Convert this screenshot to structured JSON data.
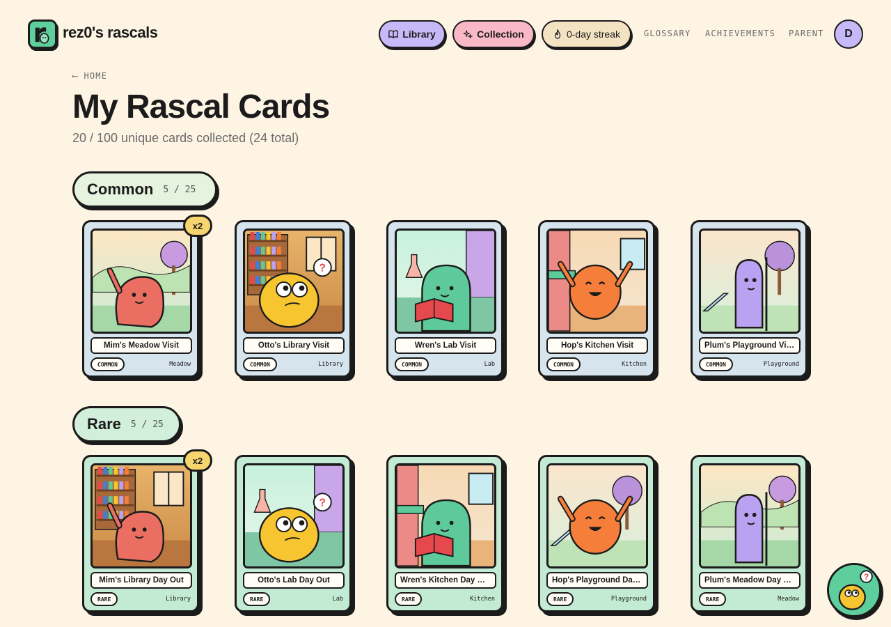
{
  "header": {
    "brand": "rez0's rascals",
    "nav": {
      "library": "Library",
      "collection": "Collection",
      "streak": "0-day streak",
      "glossary": "GLOSSARY",
      "achievements": "ACHIEVEMENTS",
      "parent": "PARENT"
    },
    "avatar_initial": "D"
  },
  "page": {
    "back": "HOME",
    "title": "My Rascal Cards",
    "subtitle": "20 / 100 unique cards collected (24 total)"
  },
  "sections": {
    "common": {
      "name": "Common",
      "count": "5 / 25"
    },
    "rare": {
      "name": "Rare",
      "count": "5 / 25"
    }
  },
  "cards": {
    "common": [
      {
        "title": "Mim's Meadow Visit",
        "rarity": "COMMON",
        "location": "Meadow",
        "dup": "x2",
        "character": "Mim",
        "color": "#ea6f62"
      },
      {
        "title": "Otto's Library Visit",
        "rarity": "COMMON",
        "location": "Library",
        "character": "Otto",
        "color": "#f6c52f"
      },
      {
        "title": "Wren's Lab Visit",
        "rarity": "COMMON",
        "location": "Lab",
        "character": "Wren",
        "color": "#5ec99a"
      },
      {
        "title": "Hop's Kitchen Visit",
        "rarity": "COMMON",
        "location": "Kitchen",
        "character": "Hop",
        "color": "#f57f3a"
      },
      {
        "title": "Plum's Playground Visit",
        "rarity": "COMMON",
        "location": "Playground",
        "character": "Plum",
        "color": "#b9a2f1"
      }
    ],
    "rare": [
      {
        "title": "Mim's Library Day Out",
        "rarity": "RARE",
        "location": "Library",
        "dup": "x2",
        "character": "Mim",
        "color": "#ea6f62"
      },
      {
        "title": "Otto's Lab Day Out",
        "rarity": "RARE",
        "location": "Lab",
        "character": "Otto",
        "color": "#f6c52f"
      },
      {
        "title": "Wren's Kitchen Day Out",
        "rarity": "RARE",
        "location": "Kitchen",
        "character": "Wren",
        "color": "#5ec99a"
      },
      {
        "title": "Hop's Playground Day ...",
        "rarity": "RARE",
        "location": "Playground",
        "character": "Hop",
        "color": "#f57f3a"
      },
      {
        "title": "Plum's Meadow Day O...",
        "rarity": "RARE",
        "location": "Meadow",
        "character": "Plum",
        "color": "#b9a2f1"
      }
    ]
  },
  "icons": {
    "library": "book-icon",
    "collection": "sparkle-icon",
    "streak": "flame-icon",
    "help": "help-mascot-icon"
  },
  "colors": {
    "background": "#fdf4e3",
    "library_pill": "#c7b8f7",
    "collection_pill": "#f9b8c6",
    "streak_pill": "#f3e3c3",
    "common_card": "#d6e4ee",
    "rare_card": "#c3ead2",
    "dup_badge": "#f6d56e"
  }
}
